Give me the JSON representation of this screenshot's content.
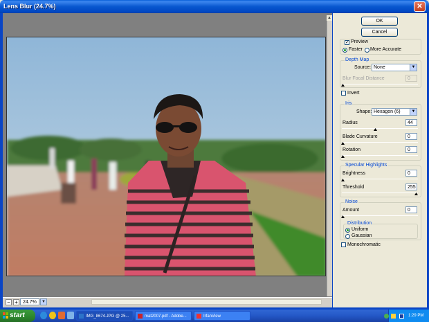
{
  "window": {
    "title": "Lens Blur (24.7%)"
  },
  "canvas": {
    "zoom": "24.7%"
  },
  "buttons": {
    "ok": "OK",
    "cancel": "Cancel"
  },
  "preview": {
    "label": "Preview",
    "checked": true,
    "modes": [
      "Faster",
      "More Accurate"
    ],
    "selected_mode": "Faster"
  },
  "depth_map": {
    "title": "Depth Map",
    "source_label": "Source:",
    "source_value": "None",
    "focal_label": "Blur Focal Distance",
    "focal_value": "0",
    "invert_label": "Invert"
  },
  "iris": {
    "title": "Iris",
    "shape_label": "Shape:",
    "shape_value": "Hexagon (6)",
    "radius_label": "Radius",
    "radius_value": "44",
    "radius_level": 0.44,
    "curvature_label": "Blade Curvature",
    "curvature_value": "0",
    "rotation_label": "Rotation",
    "rotation_value": "0"
  },
  "specular": {
    "title": "Specular Highlights",
    "brightness_label": "Brightness",
    "brightness_value": "0",
    "threshold_label": "Threshold",
    "threshold_value": "255"
  },
  "noise": {
    "title": "Noise",
    "amount_label": "Amount",
    "amount_value": "0",
    "distribution_title": "Distribution",
    "distribution_options": [
      "Uniform",
      "Gaussian"
    ],
    "selected_distribution": "Uniform",
    "monochromatic_label": "Monochromatic"
  },
  "taskbar": {
    "start_label": "start",
    "tasks": [
      "IMG_8674.JPG @ 25...",
      "mat2007.pdf - Adobe...",
      "IrfanView"
    ],
    "clock": "1:29 PM"
  },
  "colors": {
    "title_bar": "#0054e3",
    "panel_bg": "#ece9d8",
    "group_title": "#0046d5",
    "taskbar": "#245edb",
    "start_button": "#3c9c3c"
  }
}
